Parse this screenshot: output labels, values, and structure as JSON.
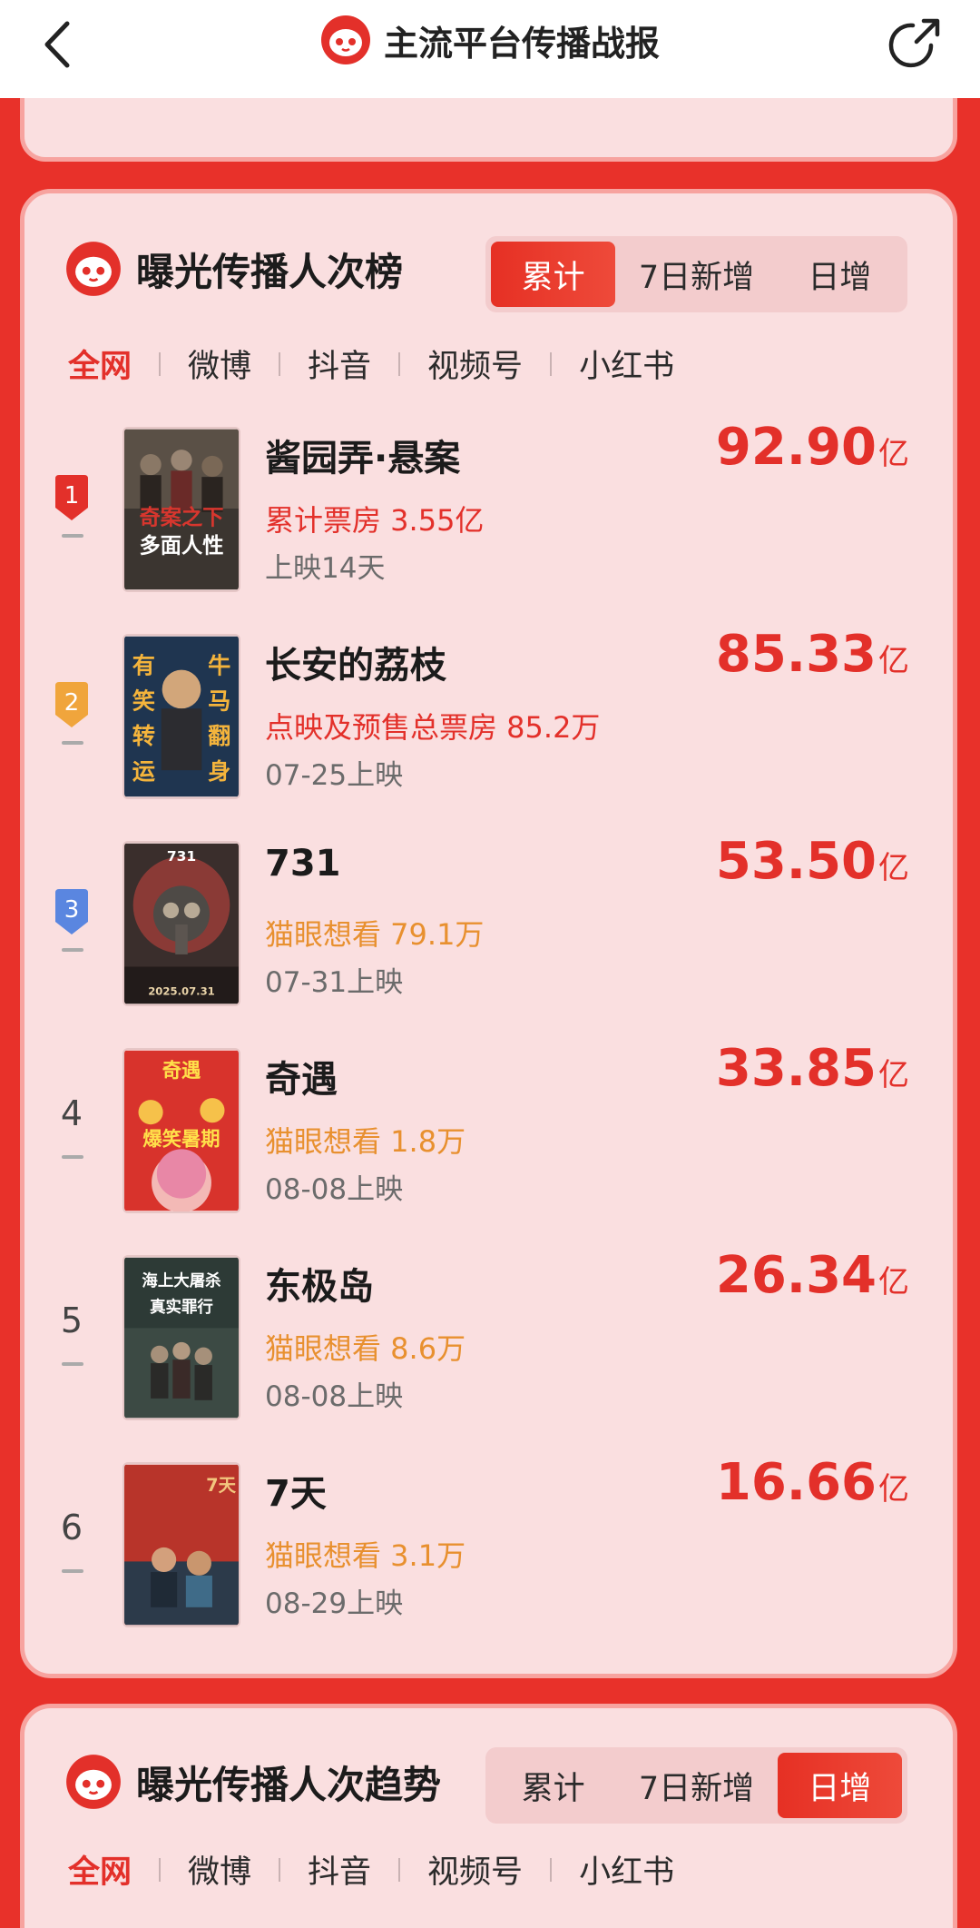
{
  "header": {
    "title": "主流平台传播战报"
  },
  "ranking": {
    "title": "曝光传播人次榜",
    "segments": [
      "累计",
      "7日新增",
      "日增"
    ],
    "active_segment": 0,
    "platforms": [
      "全网",
      "微博",
      "抖音",
      "视频号",
      "小红书"
    ],
    "active_platform": 0,
    "items": [
      {
        "rank": "1",
        "title": "酱园弄·悬案",
        "sub": "累计票房 3.55亿",
        "sub_color": "red",
        "date": "上映14天",
        "value": "92.90",
        "unit": "亿",
        "poster_text": [
          "奇案之下",
          "多面人性"
        ]
      },
      {
        "rank": "2",
        "title": "长安的荔枝",
        "sub": "点映及预售总票房 85.2万",
        "sub_color": "red",
        "date": "07-25上映",
        "value": "85.33",
        "unit": "亿",
        "poster_text": [
          "有",
          "笑",
          "转",
          "运",
          "牛",
          "马",
          "翻",
          "身"
        ]
      },
      {
        "rank": "3",
        "title": "731",
        "sub": "猫眼想看 79.1万",
        "sub_color": "orange",
        "date": "07-31上映",
        "value": "53.50",
        "unit": "亿",
        "poster_text": [
          "731",
          "2025.07.31"
        ]
      },
      {
        "rank": "4",
        "title": "奇遇",
        "sub": "猫眼想看 1.8万",
        "sub_color": "orange",
        "date": "08-08上映",
        "value": "33.85",
        "unit": "亿",
        "poster_text": [
          "奇遇",
          "爆笑暑期"
        ]
      },
      {
        "rank": "5",
        "title": "东极岛",
        "sub": "猫眼想看 8.6万",
        "sub_color": "orange",
        "date": "08-08上映",
        "value": "26.34",
        "unit": "亿",
        "poster_text": [
          "海上大屠杀",
          "真实罪行"
        ]
      },
      {
        "rank": "6",
        "title": "7天",
        "sub": "猫眼想看 3.1万",
        "sub_color": "orange",
        "date": "08-29上映",
        "value": "16.66",
        "unit": "亿",
        "poster_text": [
          "7天"
        ]
      }
    ]
  },
  "trend": {
    "title": "曝光传播人次趋势",
    "segments": [
      "累计",
      "7日新增",
      "日增"
    ],
    "active_segment": 2,
    "platforms": [
      "全网",
      "微博",
      "抖音",
      "视频号",
      "小红书"
    ],
    "active_platform": 0
  },
  "colors": {
    "brand_red": "#e3302a",
    "gold": "#f0a53c",
    "blue": "#5a86e0",
    "card_bg": "#fadfe0",
    "page_bg": "#e8312a"
  }
}
